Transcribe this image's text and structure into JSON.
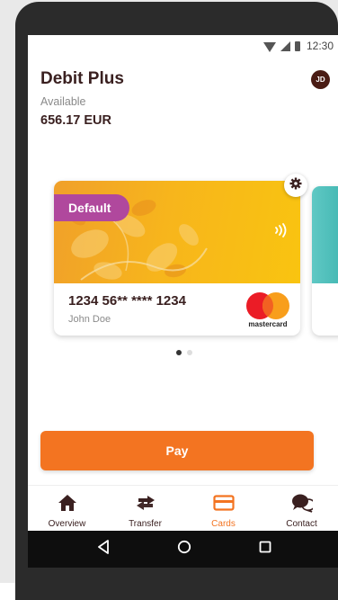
{
  "status_bar": {
    "time": "12:30"
  },
  "account": {
    "name": "Debit Plus",
    "avatar_initials": "JD",
    "available_label": "Available",
    "balance": "656.17 EUR"
  },
  "card": {
    "badge": "Default",
    "number": "1234 56** **** 1234",
    "holder": "John Doe",
    "brand": "mastercard"
  },
  "carousel": {
    "pages": 2,
    "active": 1
  },
  "pay_button": {
    "label": "Pay"
  },
  "bottom_nav": {
    "items": [
      {
        "label": "Overview",
        "icon": "home-icon"
      },
      {
        "label": "Transfer",
        "icon": "transfer-arrows-icon"
      },
      {
        "label": "Cards",
        "icon": "card-icon",
        "active": true
      },
      {
        "label": "Contact",
        "icon": "chat-bubbles-icon"
      }
    ]
  },
  "colors": {
    "accent": "#f37421",
    "badge": "#b0489d",
    "text_dark": "#3a2020",
    "avatar_bg": "#4a1c14"
  }
}
